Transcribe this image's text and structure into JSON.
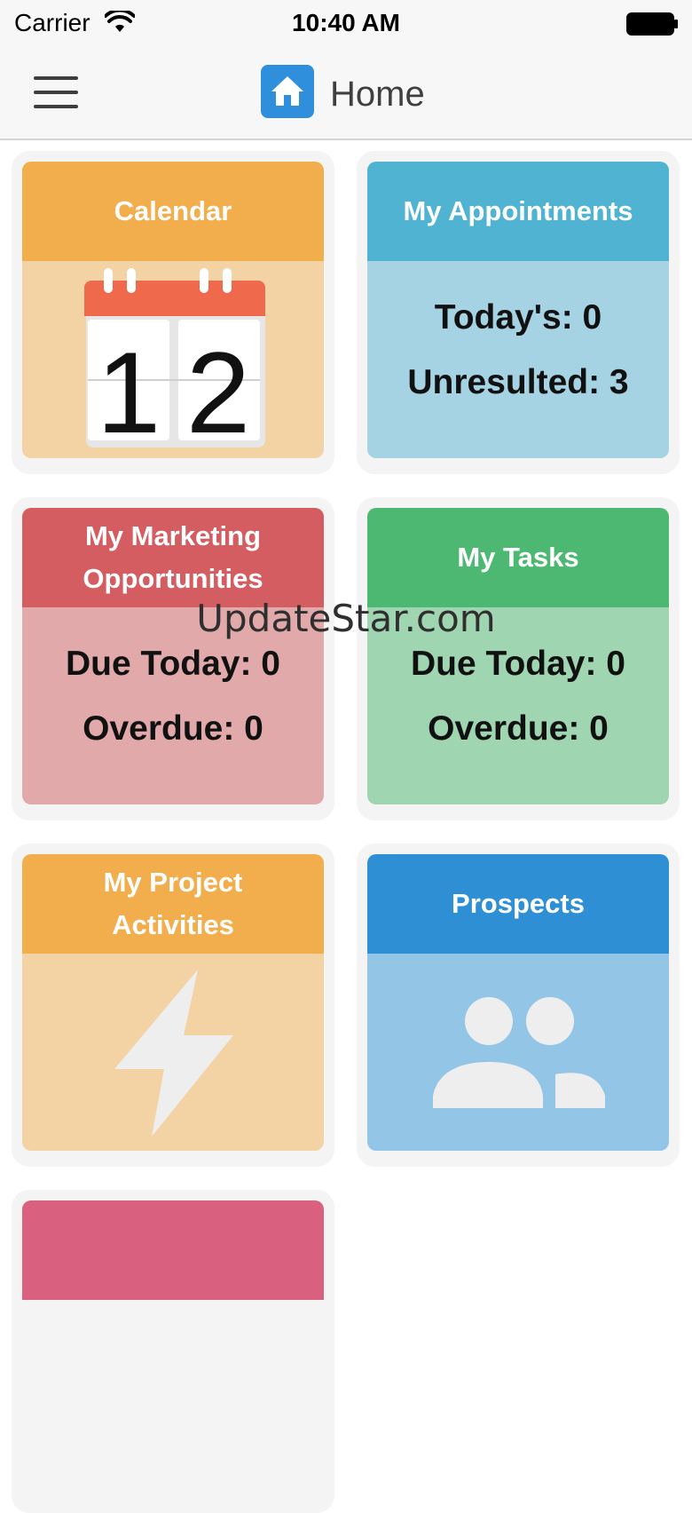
{
  "status_bar": {
    "carrier": "Carrier",
    "time": "10:40 AM",
    "wifi_icon": "wifi-icon",
    "battery_icon": "battery-icon"
  },
  "nav": {
    "title": "Home",
    "menu_icon": "hamburger-menu-icon",
    "logo_icon": "home-icon"
  },
  "tiles": {
    "calendar": {
      "title": "Calendar",
      "calendar_day": "12",
      "header_color": "#f2ad4c",
      "body_color": "#f3d2a3"
    },
    "appointments": {
      "title": "My Appointments",
      "line1": "Today's: 0",
      "line2": "Unresulted: 3",
      "header_color": "#4fb3d1",
      "body_color": "#a6d3e3"
    },
    "marketing": {
      "title_line1": "My Marketing",
      "title_line2": "Opportunities",
      "line1": "Due Today: 0",
      "line2": "Overdue: 0",
      "header_color": "#d45d62",
      "body_color": "#e2a9ab"
    },
    "tasks": {
      "title": "My Tasks",
      "line1": "Due Today: 0",
      "line2": "Overdue: 0",
      "header_color": "#4db872",
      "body_color": "#9fd5b0"
    },
    "project": {
      "title_line1": "My Project",
      "title_line2": "Activities",
      "icon": "lightning-bolt-icon",
      "header_color": "#f2ad4c",
      "body_color": "#f3d2a3"
    },
    "prospects": {
      "title": "Prospects",
      "icon": "people-icon",
      "header_color": "#2f8fd5",
      "body_color": "#92c5e6"
    },
    "partial": {
      "header_color": "#d9607f"
    }
  },
  "watermark": "UpdateStar.com"
}
